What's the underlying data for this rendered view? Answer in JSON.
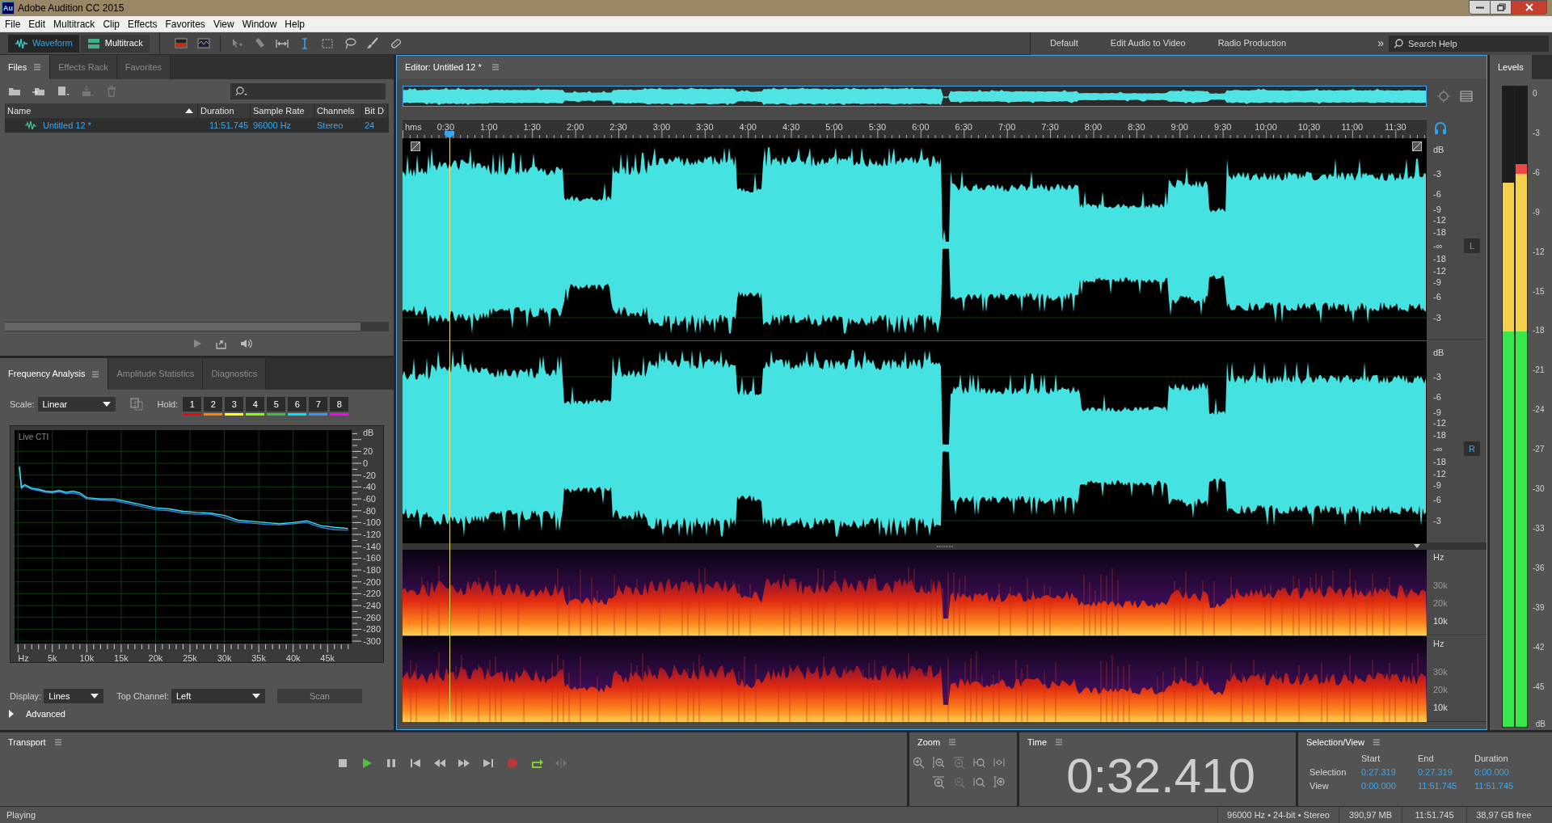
{
  "window": {
    "title": "Adobe Audition CC 2015",
    "app_icon": "Au"
  },
  "menu": [
    "File",
    "Edit",
    "Multitrack",
    "Clip",
    "Effects",
    "Favorites",
    "View",
    "Window",
    "Help"
  ],
  "toolbar": {
    "views": [
      {
        "label": "Waveform",
        "selected": true
      },
      {
        "label": "Multitrack",
        "selected": false
      }
    ],
    "workspaces": [
      "Default",
      "Edit Audio to Video",
      "Radio Production"
    ],
    "more": "»",
    "search": {
      "placeholder": "Search Help"
    }
  },
  "files_panel": {
    "tabs": [
      {
        "label": "Files",
        "selected": true
      },
      {
        "label": "Effects Rack",
        "selected": false
      },
      {
        "label": "Favorites",
        "selected": false
      }
    ],
    "table": {
      "columns": [
        "Name",
        "Duration",
        "Sample Rate",
        "Channels",
        "Bit D"
      ],
      "rows": [
        {
          "cells": [
            "Untitled 12 *",
            "11:51.745",
            "96000 Hz",
            "Stereo",
            "24"
          ],
          "selected": true
        }
      ]
    }
  },
  "analysis_panel": {
    "tabs": [
      {
        "label": "Frequency Analysis",
        "selected": true
      },
      {
        "label": "Amplitude Statistics",
        "selected": false
      },
      {
        "label": "Diagnostics",
        "selected": false
      }
    ],
    "scale": {
      "label": "Scale:",
      "value": "Linear"
    },
    "hold": {
      "label": "Hold:",
      "buttons": [
        {
          "label": "1",
          "color": "#ff0000"
        },
        {
          "label": "2",
          "color": "#ff7f00"
        },
        {
          "label": "3",
          "color": "#ffff00"
        },
        {
          "label": "4",
          "color": "#7fff00"
        },
        {
          "label": "5",
          "color": "#3fbf3f"
        },
        {
          "label": "6",
          "color": "#00e5ff"
        },
        {
          "label": "7",
          "color": "#3399ff"
        },
        {
          "label": "8",
          "color": "#ff00ff"
        }
      ]
    },
    "chart_data": {
      "type": "line",
      "title": "Live CTI",
      "ylabel": "dB",
      "xlim": [
        -500,
        48500
      ],
      "ylim": [
        -304,
        56
      ],
      "x": [
        200,
        500,
        1000,
        2000,
        3000,
        4000,
        5000,
        6000,
        7000,
        8000,
        9000,
        10000,
        12000,
        14000,
        16000,
        18000,
        20000,
        22000,
        24000,
        26000,
        28000,
        30000,
        32000,
        34000,
        36000,
        38000,
        40000,
        42000,
        44000,
        46000,
        48000
      ],
      "grid": true,
      "series": [
        {
          "color": "#3a7fe0",
          "values": [
            -8,
            -42,
            -38,
            -44,
            -46,
            -49,
            -50,
            -48,
            -51,
            -50,
            -53,
            -60,
            -62,
            -63,
            -68,
            -73,
            -78,
            -80,
            -84,
            -86,
            -86,
            -92,
            -99,
            -101,
            -103,
            -104,
            -102,
            -100,
            -108,
            -112,
            -113
          ]
        },
        {
          "color": "#40e0f0",
          "values": [
            -5,
            -40,
            -36,
            -42,
            -44,
            -47,
            -48,
            -46,
            -49,
            -47,
            -50,
            -58,
            -60,
            -60,
            -65,
            -70,
            -75,
            -77,
            -81,
            -83,
            -84,
            -88,
            -96,
            -98,
            -100,
            -102,
            -100,
            -97,
            -105,
            -108,
            -110
          ]
        }
      ],
      "xticks": [
        {
          "value": 0,
          "label": "Hz"
        },
        {
          "value": 5000,
          "label": "5k"
        },
        {
          "value": 10000,
          "label": "10k"
        },
        {
          "value": 15000,
          "label": "15k"
        },
        {
          "value": 20000,
          "label": "20k"
        },
        {
          "value": 25000,
          "label": "25k"
        },
        {
          "value": 30000,
          "label": "30k"
        },
        {
          "value": 35000,
          "label": "35k"
        },
        {
          "value": 40000,
          "label": "40k"
        },
        {
          "value": 45000,
          "label": "45k"
        }
      ],
      "yticks": [
        20,
        0,
        -20,
        -40,
        -60,
        -80,
        -100,
        -120,
        -140,
        -160,
        -180,
        -200,
        -220,
        -240,
        -260,
        -280,
        -300
      ]
    },
    "display": {
      "label": "Display:",
      "value": "Lines"
    },
    "top_channel": {
      "label": "Top Channel:",
      "value": "Left"
    },
    "scan_button": "Scan",
    "advanced": {
      "label": "Advanced",
      "expanded": false
    }
  },
  "editor": {
    "tab": "Editor: Untitled 12 *",
    "ruler": {
      "unit": "hms",
      "labels": [
        "0:30",
        "1:00",
        "1:30",
        "2:00",
        "2:30",
        "3:00",
        "3:30",
        "4:00",
        "4:30",
        "5:00",
        "5:30",
        "6:00",
        "6:30",
        "7:00",
        "7:30",
        "8:00",
        "8:30",
        "9:00",
        "9:30",
        "10:00",
        "10:30",
        "11:00",
        "11:30"
      ]
    },
    "playhead": {
      "level": 0.0455
    },
    "channels": [
      {
        "badge": "L",
        "scale": [
          "dB",
          "-3",
          "-6",
          "-9",
          "-12",
          "-18",
          "-∞",
          "-18",
          "-12",
          "-9",
          "-6",
          "-3"
        ]
      },
      {
        "badge": "R",
        "scale": [
          "dB",
          "-3",
          "-6",
          "-9",
          "-12",
          "-18",
          "-∞",
          "-18",
          "-12",
          "-9",
          "-6",
          "-3"
        ]
      }
    ],
    "spectral": [
      {
        "scale": [
          "Hz",
          "30k",
          "20k",
          "10k"
        ]
      },
      {
        "scale": [
          "Hz",
          "30k",
          "20k",
          "10k"
        ]
      }
    ]
  },
  "levels": {
    "tab": "Levels",
    "meters": [
      {
        "level": 0.85
      },
      {
        "level": 0.879
      }
    ],
    "scale": [
      "0",
      "-3",
      "-6",
      "-9",
      "-12",
      "-15",
      "-18",
      "-21",
      "-24",
      "-27",
      "-30",
      "-33",
      "-36",
      "-39",
      "-42",
      "-45"
    ],
    "unit": "dB"
  },
  "transport": {
    "title": "Transport"
  },
  "zoom": {
    "title": "Zoom"
  },
  "time": {
    "title": "Time",
    "value": "0:32.410"
  },
  "selection_view": {
    "title": "Selection/View",
    "columns": [
      "Start",
      "End",
      "Duration"
    ],
    "rows": [
      {
        "label": "Selection",
        "values": [
          "0:27.319",
          "0:27.319",
          "0:00.000"
        ]
      },
      {
        "label": "View",
        "values": [
          "0:00.000",
          "11:51.745",
          "11:51.745"
        ]
      }
    ]
  },
  "status_bar": {
    "state": "Playing",
    "items": [
      "96000 Hz • 24-bit • Stereo",
      "390,97 MB",
      "11:51.745",
      "38,97 GB free"
    ]
  }
}
